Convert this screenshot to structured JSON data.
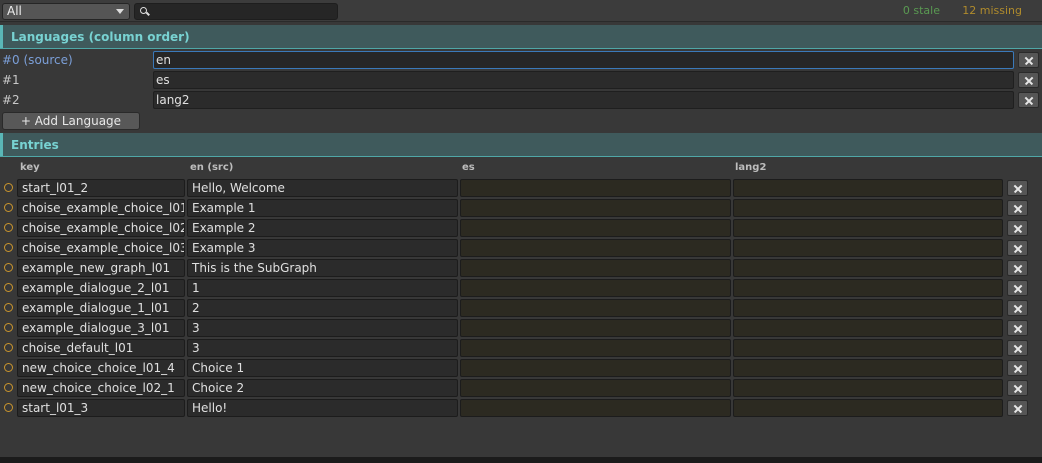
{
  "toolbar": {
    "filter": "All",
    "search_placeholder": "",
    "stale": "0 stale",
    "missing": "12 missing"
  },
  "languages": {
    "header": "Languages (column order)",
    "items": [
      {
        "label": "#0 (source)",
        "code": "en"
      },
      {
        "label": "#1",
        "code": "es"
      },
      {
        "label": "#2",
        "code": "lang2"
      }
    ],
    "add_label": "+ Add Language"
  },
  "entries": {
    "header": "Entries",
    "columns": [
      "key",
      "en (src)",
      "es",
      "lang2"
    ],
    "rows": [
      {
        "key": "start_l01_2",
        "en": "Hello, Welcome",
        "es": "",
        "lang2": ""
      },
      {
        "key": "choise_example_choice_l01",
        "en": "Example 1",
        "es": "",
        "lang2": ""
      },
      {
        "key": "choise_example_choice_l02",
        "en": "Example 2",
        "es": "",
        "lang2": ""
      },
      {
        "key": "choise_example_choice_l03",
        "en": "Example 3",
        "es": "",
        "lang2": ""
      },
      {
        "key": "example_new_graph_l01",
        "en": "This is the SubGraph",
        "es": "",
        "lang2": ""
      },
      {
        "key": "example_dialogue_2_l01",
        "en": "1",
        "es": "",
        "lang2": ""
      },
      {
        "key": "example_dialogue_1_l01",
        "en": "2",
        "es": "",
        "lang2": ""
      },
      {
        "key": "example_dialogue_3_l01",
        "en": "3",
        "es": "",
        "lang2": ""
      },
      {
        "key": "choise_default_l01",
        "en": "3",
        "es": "",
        "lang2": ""
      },
      {
        "key": "new_choice_choice_l01_4",
        "en": "Choice 1",
        "es": "",
        "lang2": ""
      },
      {
        "key": "new_choice_choice_l02_1",
        "en": "Choice 2",
        "es": "",
        "lang2": ""
      },
      {
        "key": "start_l01_3",
        "en": "Hello!",
        "es": "",
        "lang2": ""
      }
    ]
  },
  "icons": {
    "filter_caret": "chevron-down-icon",
    "search": "search-icon",
    "remove": "close-icon",
    "status": "status-circle-icon"
  },
  "colors": {
    "accent_teal": "#5ab7b7",
    "stale_green": "#5a9a52",
    "missing_gold": "#b08b2c",
    "status_circle": "#c9952d"
  }
}
